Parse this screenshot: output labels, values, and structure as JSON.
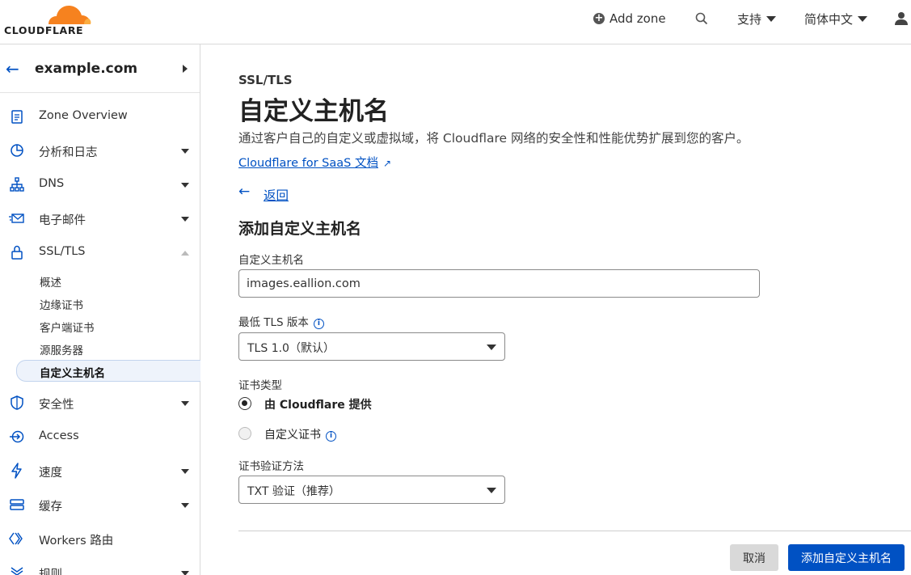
{
  "header": {
    "logo_text": "CLOUDFLARE",
    "add_zone": "Add zone",
    "support": "支持",
    "language": "简体中文"
  },
  "sidebar": {
    "zone": "example.com",
    "items": [
      {
        "label": "Zone Overview"
      },
      {
        "label": "分析和日志"
      },
      {
        "label": "DNS"
      },
      {
        "label": "电子邮件"
      },
      {
        "label": "SSL/TLS"
      },
      {
        "label": "安全性"
      },
      {
        "label": "Access"
      },
      {
        "label": "速度"
      },
      {
        "label": "缓存"
      },
      {
        "label": "Workers 路由"
      },
      {
        "label": "规则"
      }
    ],
    "ssl_sub": [
      "概述",
      "边缘证书",
      "客户端证书",
      "源服务器",
      "自定义主机名"
    ]
  },
  "main": {
    "breadcrumb": "SSL/TLS",
    "title": "自定义主机名",
    "description": "通过客户自己的自定义或虚拟域，将 Cloudflare 网络的安全性和性能优势扩展到您的客户。",
    "doc_link": "Cloudflare for SaaS 文档",
    "back": "返回",
    "section_title": "添加自定义主机名",
    "hostname_label": "自定义主机名",
    "hostname_value": "images.eallion.com",
    "tls_label": "最低 TLS 版本",
    "tls_value": "TLS 1.0（默认）",
    "cert_type_label": "证书类型",
    "cert_option_1": "由 Cloudflare 提供",
    "cert_option_2": "自定义证书",
    "validation_label": "证书验证方法",
    "validation_value": "TXT 验证（推荐）",
    "cancel": "取消",
    "submit": "添加自定义主机名"
  }
}
